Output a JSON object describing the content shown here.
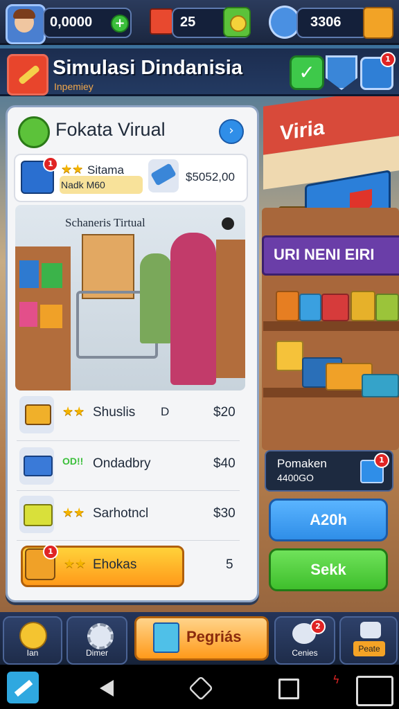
{
  "topbar": {
    "coins": "0,0000",
    "gems": "25",
    "tickets": "3306"
  },
  "title": {
    "text": "Simulasi Dindanisia",
    "subtitle": "Inpemiey"
  },
  "panel": {
    "heading": "Fokata Virual",
    "featured": {
      "name": "Sitama",
      "sub": "Nadk M60",
      "price": "$5052,00"
    },
    "scene_label": "Schaneris Tirtual",
    "items": [
      {
        "name": "Shuslis",
        "qty": "D",
        "price": "$20"
      },
      {
        "name": "Ondadbry",
        "tag": "OD!!",
        "price": "$40"
      },
      {
        "name": "Sarhotncl",
        "price": "$30"
      }
    ],
    "highlight": {
      "name": "Ehokas",
      "count": "5"
    }
  },
  "store_sign": "URI NENI EIRI",
  "store_banner": "Viria",
  "right_panel": {
    "title": "Pomaken",
    "subtitle": "4400GO",
    "button_blue": "A20h",
    "button_green": "Sekk"
  },
  "nav": {
    "item1": "Ian",
    "item2": "Dimer",
    "center": "Pegriás",
    "item4": "Cenies",
    "item5": "Peate"
  },
  "colors": {
    "blue_button": "#2f8ee8",
    "green_button": "#3fbf2c",
    "orange_button": "#ff9a1a",
    "badge": "#e02424"
  }
}
